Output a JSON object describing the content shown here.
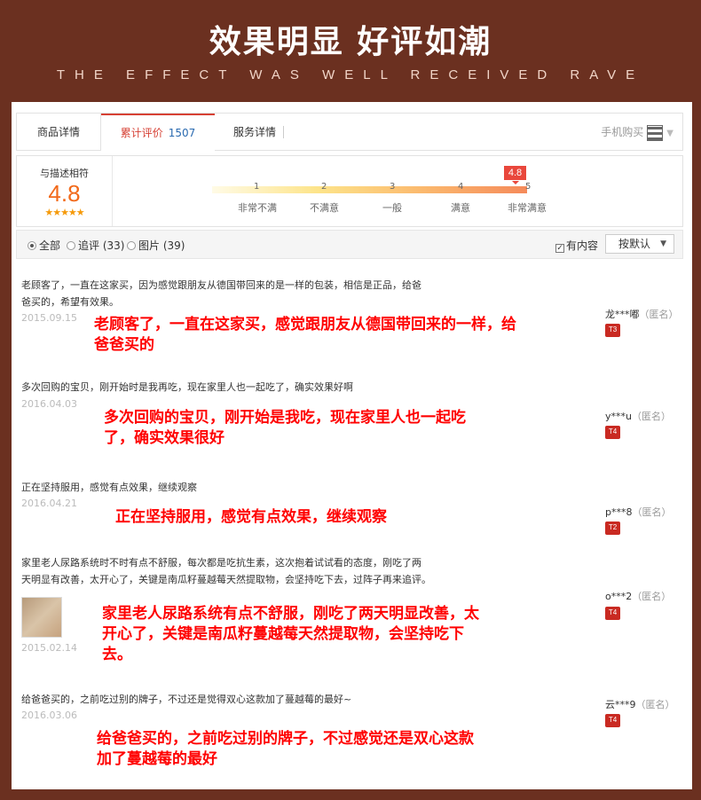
{
  "hero": {
    "title": "效果明显 好评如潮",
    "subtitle": "THE EFFECT WAS WELL RECEIVED RAVE"
  },
  "tabs": {
    "desc": "商品详情",
    "reviews": "累计评价",
    "reviews_count": "1507",
    "service": "服务详情",
    "mobile_buy": "手机购买"
  },
  "rating": {
    "label": "与描述相符",
    "score": "4.8",
    "stars": "★★★★★",
    "bubble": "4.8",
    "ticks": [
      "1",
      "2",
      "3",
      "4",
      "5"
    ],
    "tick_labels": [
      "非常不满",
      "不满意",
      "一般",
      "满意",
      "非常满意"
    ],
    "score_fraction": 0.95
  },
  "filters": {
    "all": "全部",
    "append": "追评 (33)",
    "photos": "图片 (39)",
    "has_content": "有内容",
    "sort": "按默认"
  },
  "reviews": [
    {
      "text1": "老顾客了，一直在这家买，因为感觉跟朋友从德国带回来的是一样的包装，相信是正品，给爸",
      "text2": "爸买的，希望有效果。",
      "date": "2015.09.15",
      "red1": "老顾客了，一直在这家买，感觉跟朋友从德国带回来的一样，给",
      "red2": "爸爸买的",
      "user": "龙***嘟",
      "anon": "（匿名）",
      "badge": "T3"
    },
    {
      "text1": "多次回购的宝贝，刚开始时是我再吃，现在家里人也一起吃了，确实效果好啊",
      "text2": "",
      "date": "2016.04.03",
      "red1": "多次回购的宝贝，刚开始是我吃，现在家里人也一起吃",
      "red2": "了，确实效果很好",
      "user": "y***u",
      "anon": "（匿名）",
      "badge": "T4"
    },
    {
      "text1": "正在坚持服用，感觉有点效果，继续观察",
      "text2": "",
      "date": "2016.04.21",
      "red1": "正在坚持服用，感觉有点效果，继续观察",
      "red2": "",
      "user": "p***8",
      "anon": "（匿名）",
      "badge": "T2"
    },
    {
      "text1": "家里老人尿路系统时不时有点不舒服，每次都是吃抗生素，这次抱着试试看的态度，刚吃了两",
      "text2": "天明显有改善，太开心了，关键是南瓜籽蔓越莓天然提取物，会坚持吃下去，过阵子再来追评。",
      "date": "2015.02.14",
      "red1": "家里老人尿路系统有点不舒服，刚吃了两天明显改善，太",
      "red2": "开心了，关键是南瓜籽蔓越莓天然提取物，会坚持吃下",
      "red3": "去。",
      "user": "o***2",
      "anon": "（匿名）",
      "badge": "T4"
    },
    {
      "text1": "给爸爸买的，之前吃过别的牌子，不过还是觉得双心这款加了蔓越莓的最好~",
      "text2": "",
      "date": "2016.03.06",
      "red1": "给爸爸买的，之前吃过别的牌子，不过感觉还是双心这款",
      "red2": "加了蔓越莓的最好",
      "user": "云***9",
      "anon": "（匿名）",
      "badge": "T4"
    }
  ],
  "colors": {
    "background": "#6b3020",
    "accent": "#d64034",
    "score": "#f26a1b",
    "annotation": "#ff0000"
  }
}
